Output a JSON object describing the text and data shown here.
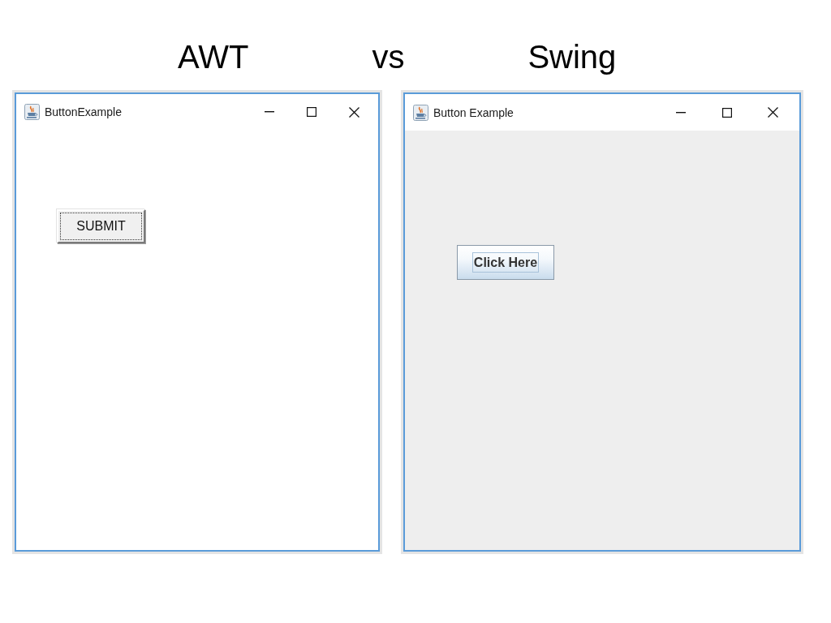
{
  "headings": [
    "AWT",
    "vs",
    "Swing"
  ],
  "windows": [
    {
      "kind": "awt",
      "title": "ButtonExample",
      "button": {
        "label": "SUBMIT",
        "focused": true
      }
    },
    {
      "kind": "swing",
      "title": "Button Example",
      "button": {
        "label": "Click Here",
        "focused": true
      }
    }
  ]
}
